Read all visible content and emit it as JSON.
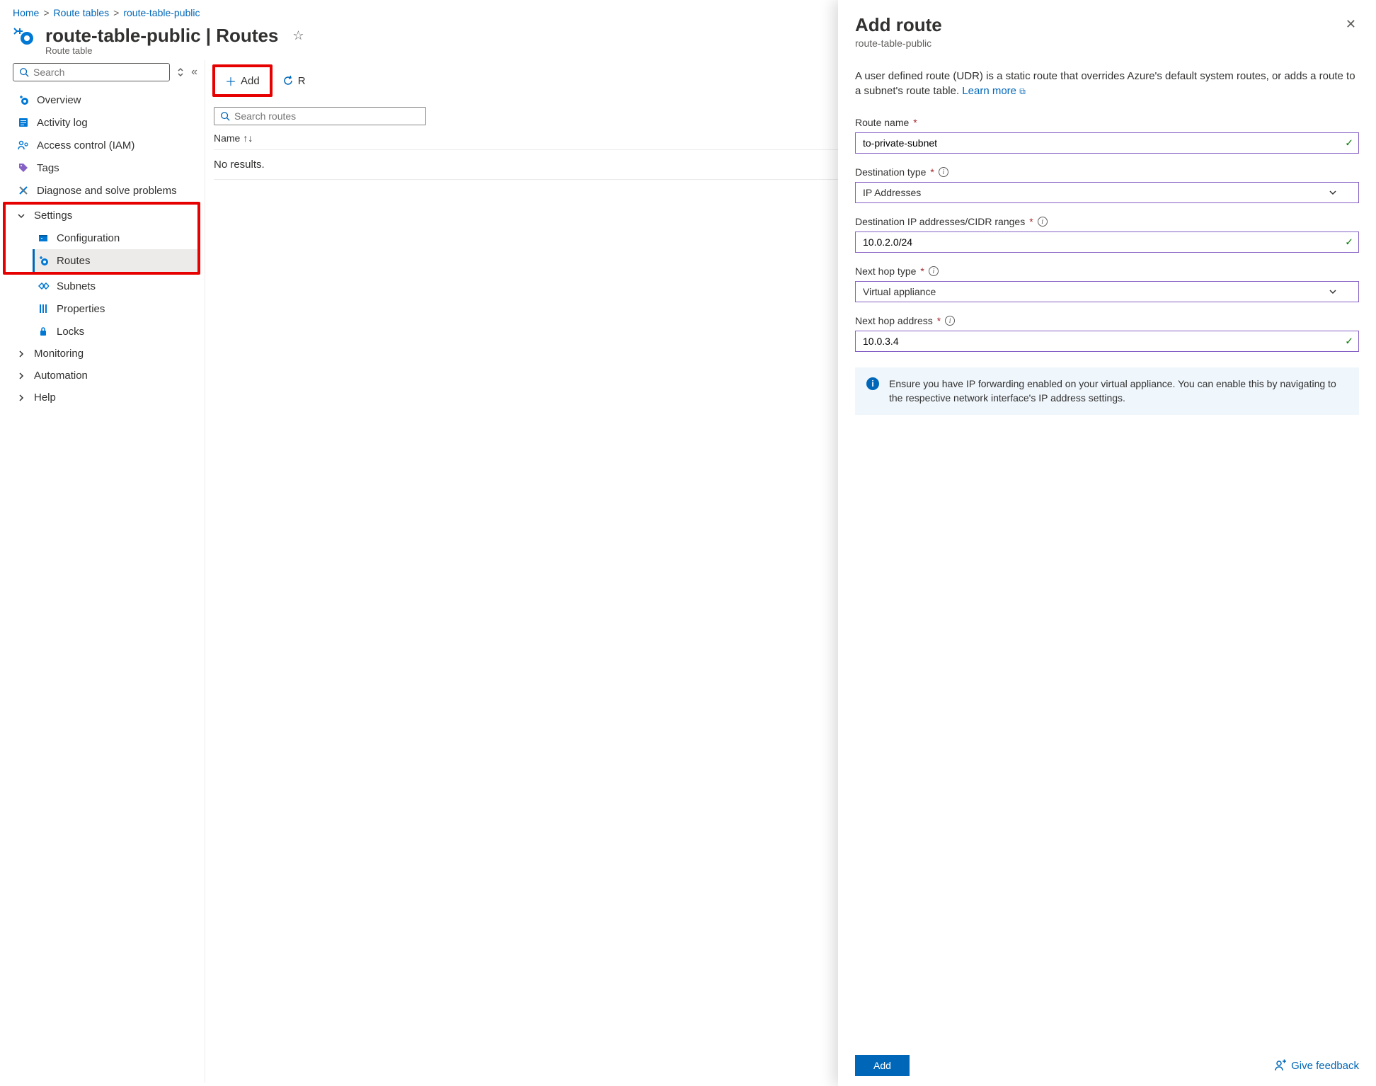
{
  "breadcrumb": {
    "home": "Home",
    "level1": "Route tables",
    "current": "route-table-public"
  },
  "page": {
    "title": "route-table-public | Routes",
    "subtitle": "Route table"
  },
  "sidebar": {
    "search_placeholder": "Search",
    "overview": "Overview",
    "activity_log": "Activity log",
    "iam": "Access control (IAM)",
    "tags": "Tags",
    "diagnose": "Diagnose and solve problems",
    "settings": "Settings",
    "configuration": "Configuration",
    "routes": "Routes",
    "subnets": "Subnets",
    "properties": "Properties",
    "locks": "Locks",
    "monitoring": "Monitoring",
    "automation": "Automation",
    "help": "Help"
  },
  "toolbar": {
    "add": "Add",
    "refresh": "R"
  },
  "table": {
    "search_placeholder": "Search routes",
    "col_name": "Name",
    "no_results": "No results."
  },
  "panel": {
    "title": "Add route",
    "subtitle": "route-table-public",
    "description": "A user defined route (UDR) is a static route that overrides Azure's default system routes, or adds a route to a subnet's route table. ",
    "learn_more": "Learn more",
    "fields": {
      "route_name": {
        "label": "Route name",
        "value": "to-private-subnet"
      },
      "dest_type": {
        "label": "Destination type",
        "value": "IP Addresses"
      },
      "dest_ip": {
        "label": "Destination IP addresses/CIDR ranges",
        "value": "10.0.2.0/24"
      },
      "next_hop_type": {
        "label": "Next hop type",
        "value": "Virtual appliance"
      },
      "next_hop_addr": {
        "label": "Next hop address",
        "value": "10.0.3.4"
      }
    },
    "info_box": "Ensure you have IP forwarding enabled on your virtual appliance. You can enable this by navigating to the respective network interface's IP address settings.",
    "add_button": "Add",
    "feedback": "Give feedback"
  }
}
